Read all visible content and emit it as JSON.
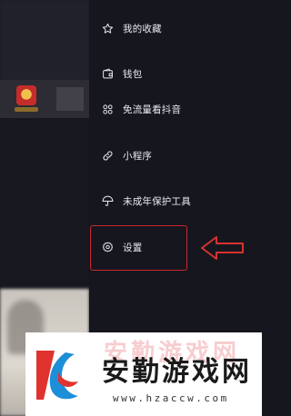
{
  "menu": {
    "items": [
      {
        "label": "我的收藏",
        "icon": "star-icon"
      },
      {
        "label": "钱包",
        "icon": "wallet-icon"
      },
      {
        "label": "免流量看抖音",
        "icon": "grid-icon"
      },
      {
        "label": "小程序",
        "icon": "link-icon"
      },
      {
        "label": "未成年保护工具",
        "icon": "umbrella-icon"
      },
      {
        "label": "设置",
        "icon": "gear-icon"
      }
    ]
  },
  "annotation": {
    "highlight_color": "#c8282b",
    "highlighted_item": "设置"
  },
  "watermark": {
    "title": "安勤游戏网",
    "url": "www.hzaccw.com",
    "logo_colors": [
      "#e0322f",
      "#1d8fd8"
    ]
  }
}
